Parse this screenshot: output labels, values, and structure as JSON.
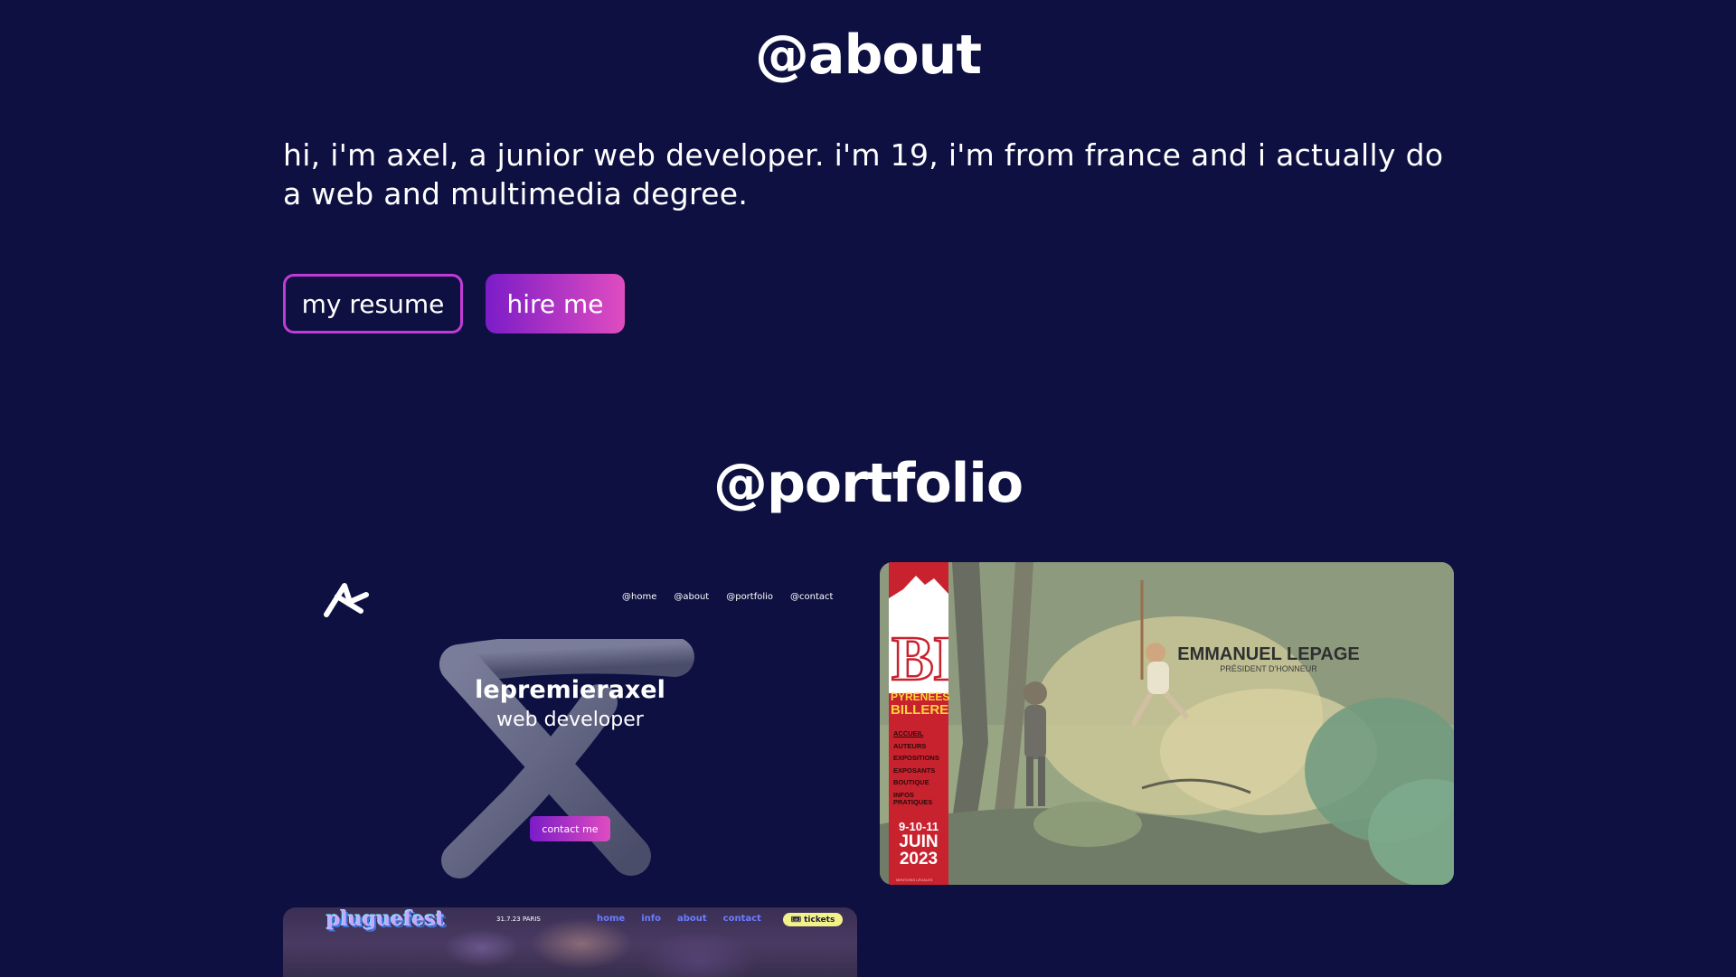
{
  "about": {
    "title": "@about",
    "text": "hi, i'm axel, a junior web developer. i'm 19, i'm from france and i actually do a web and multimedia degree.",
    "resume_button": "my resume",
    "hire_button": "hire me"
  },
  "portfolio": {
    "title": "@portfolio",
    "projects": [
      {
        "nav": [
          "@home",
          "@about",
          "@portfolio",
          "@contact"
        ],
        "name": "lepremieraxel",
        "role": "web developer",
        "cta": "contact me"
      },
      {
        "logo": "BD",
        "brand_line1": "PYRENEES",
        "brand_line2": "BILLERE",
        "menu": [
          "ACCUEIL",
          "AUTEURS",
          "EXPOSITIONS",
          "EXPOSANTS",
          "BOUTIQUE",
          "INFOS",
          "PRATIQUES"
        ],
        "date_days": "9-10-11",
        "date_month": "JUIN",
        "date_year": "2023",
        "legal": "MENTIONS LÉGALES",
        "person": "EMMANUEL LEPAGE",
        "person_role": "PRÉSIDENT D'HONNEUR"
      },
      {
        "logo": "pluguefest",
        "date_place": "31.7.23 PARIS",
        "nav": [
          "home",
          "info",
          "about",
          "contact"
        ],
        "tickets": "tickets"
      }
    ]
  },
  "colors": {
    "background": "#0d1040",
    "accent_start": "#7b1cc8",
    "accent_end": "#e04cc0"
  }
}
